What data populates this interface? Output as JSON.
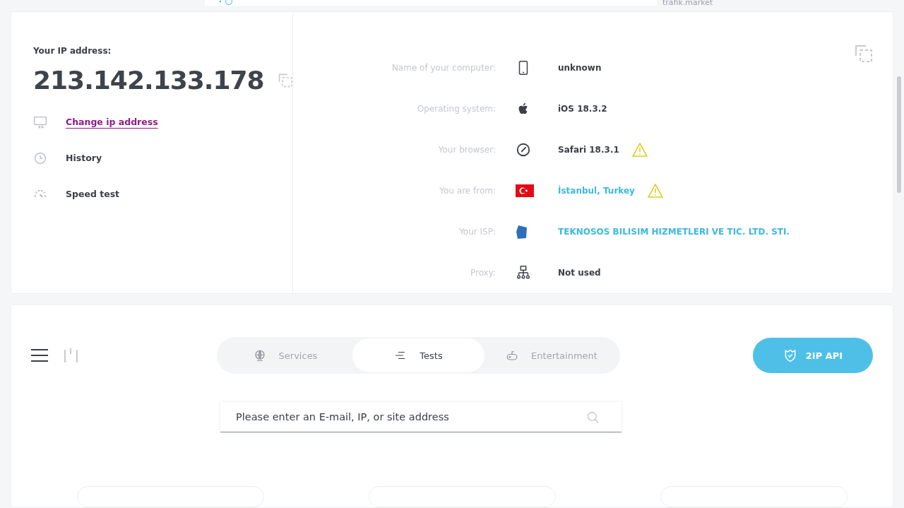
{
  "top_banner": {
    "text": "trafik.market"
  },
  "ip_panel": {
    "label": "Your IP address:",
    "ip": "213.142.133.178",
    "actions": [
      {
        "kind": "change",
        "label": "Change ip address",
        "link": true
      },
      {
        "kind": "history",
        "label": "History",
        "link": false
      },
      {
        "kind": "speed",
        "label": "Speed test",
        "link": false
      }
    ]
  },
  "info_rows": [
    {
      "kind": "device",
      "label": "Name of your computer:",
      "value": "unknown",
      "link": false,
      "warning": false
    },
    {
      "kind": "os",
      "label": "Operating system:",
      "value": "iOS 18.3.2",
      "link": false,
      "warning": false
    },
    {
      "kind": "browser",
      "label": "Your browser:",
      "value": "Safari 18.3.1",
      "link": false,
      "warning": true
    },
    {
      "kind": "flag",
      "label": "You are from:",
      "value": "İstanbul, Turkey",
      "link": true,
      "warning": true
    },
    {
      "kind": "isp",
      "label": "Your ISP:",
      "value": "TEKNOSOS BILISIM HIZMETLERI VE TIC. LTD. STI.",
      "link": true,
      "warning": false
    },
    {
      "kind": "proxy",
      "label": "Proxy:",
      "value": "Not used",
      "link": false,
      "warning": false
    }
  ],
  "tabs": [
    {
      "kind": "globe",
      "label": "Services",
      "selected": false
    },
    {
      "kind": "lines",
      "label": "Tests",
      "selected": true
    },
    {
      "kind": "gamepad",
      "label": "Entertainment",
      "selected": false
    }
  ],
  "api_button": {
    "label": "2IP API"
  },
  "search": {
    "placeholder": "Please enter an E-mail, IP, or site address"
  }
}
